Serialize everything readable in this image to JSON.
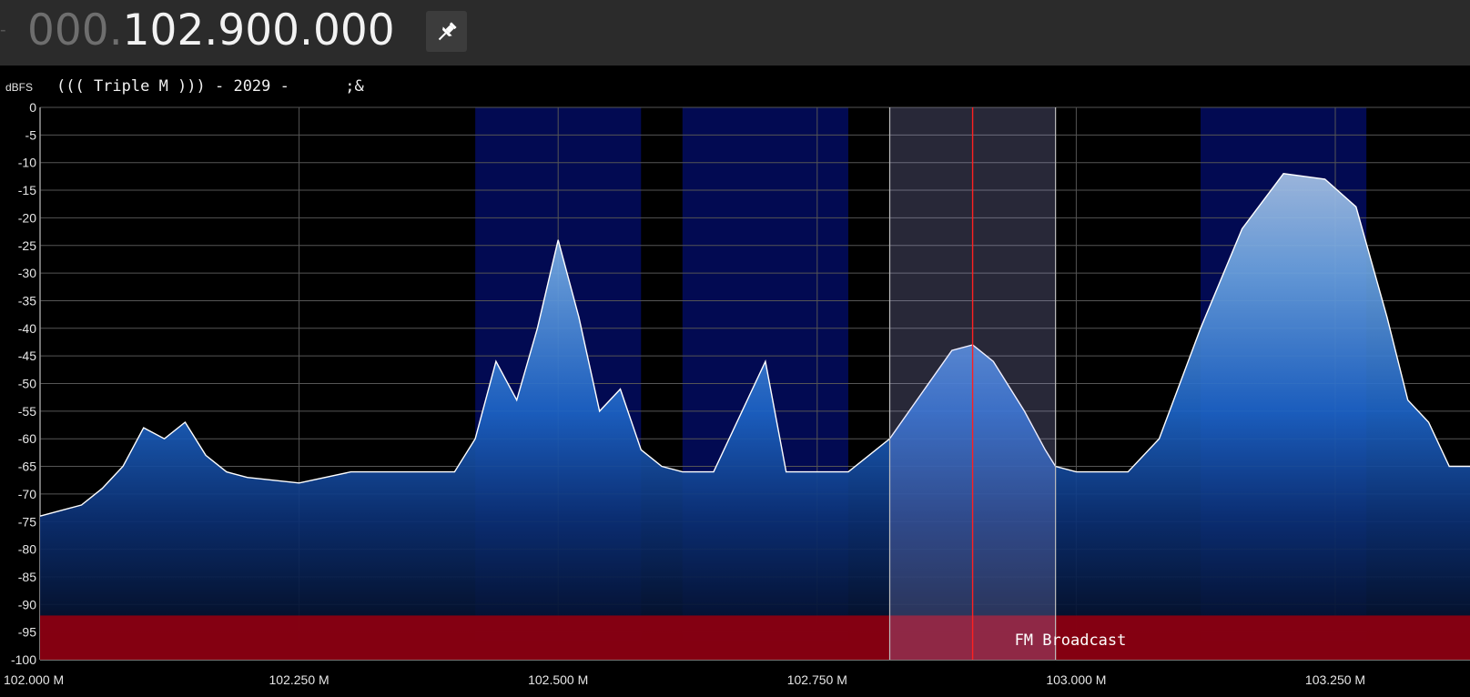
{
  "frequency": {
    "prefix": "000.",
    "value": "102.900.000"
  },
  "rds_text": "((( Triple M ))) - 2029 -      ;&",
  "y_axis_unit": "dBFS",
  "y_ticks": [
    "0",
    "-5",
    "-10",
    "-15",
    "-20",
    "-25",
    "-30",
    "-35",
    "-40",
    "-45",
    "-50",
    "-55",
    "-60",
    "-65",
    "-70",
    "-75",
    "-80",
    "-85",
    "-90",
    "-95",
    "-100"
  ],
  "x_ticks": [
    "102.000 M",
    "102.250 M",
    "102.500 M",
    "102.750 M",
    "103.000 M",
    "103.250 M"
  ],
  "band_label": "FM Broadcast",
  "colors": {
    "band": "#8b0011",
    "station": "#020a52",
    "selection": "#3a3a78",
    "tuned_line": "#ff2020",
    "trace": "#ffffff"
  },
  "chart_data": {
    "type": "area",
    "xlabel": "",
    "ylabel": "dBFS",
    "xlim": [
      102.0,
      103.38
    ],
    "ylim": [
      -100,
      0
    ],
    "tuned_frequency": 102.9,
    "selection": [
      102.82,
      102.98
    ],
    "stations": [
      [
        102.42,
        102.58
      ],
      [
        102.62,
        102.78
      ],
      [
        103.12,
        103.28
      ]
    ],
    "x": [
      102.0,
      102.02,
      102.04,
      102.06,
      102.08,
      102.1,
      102.12,
      102.14,
      102.16,
      102.18,
      102.2,
      102.25,
      102.3,
      102.35,
      102.4,
      102.42,
      102.44,
      102.46,
      102.48,
      102.5,
      102.52,
      102.54,
      102.56,
      102.58,
      102.6,
      102.62,
      102.65,
      102.7,
      102.72,
      102.75,
      102.78,
      102.8,
      102.82,
      102.85,
      102.88,
      102.9,
      102.92,
      102.95,
      102.97,
      102.98,
      103.0,
      103.05,
      103.08,
      103.12,
      103.16,
      103.2,
      103.24,
      103.27,
      103.3,
      103.32,
      103.34,
      103.36,
      103.38
    ],
    "y": [
      -74,
      -73,
      -72,
      -69,
      -65,
      -58,
      -60,
      -57,
      -63,
      -66,
      -67,
      -68,
      -66,
      -66,
      -66,
      -60,
      -46,
      -53,
      -40,
      -24,
      -38,
      -55,
      -51,
      -62,
      -65,
      -66,
      -66,
      -46,
      -66,
      -66,
      -66,
      -63,
      -60,
      -52,
      -44,
      -43,
      -46,
      -55,
      -62,
      -65,
      -66,
      -66,
      -60,
      -40,
      -22,
      -12,
      -13,
      -18,
      -38,
      -53,
      -57,
      -65,
      -65
    ]
  }
}
